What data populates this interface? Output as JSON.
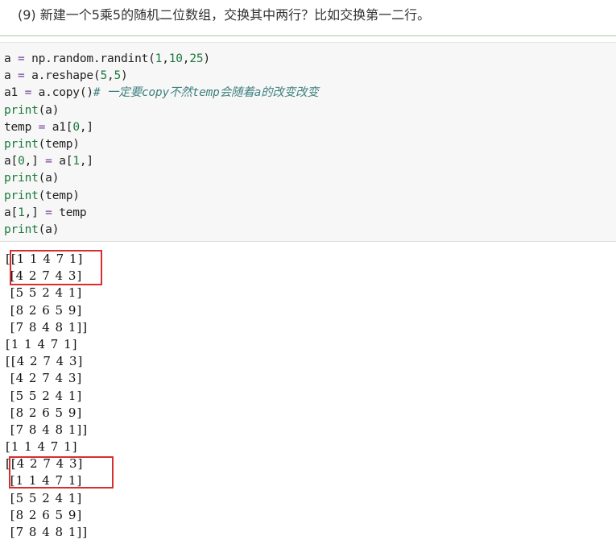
{
  "heading": {
    "text": "(9) 新建一个5乘5的随机二位数组，交换其中两行？比如交换第一二行。"
  },
  "code": {
    "lines": [
      [
        {
          "t": "a",
          "c": "var"
        },
        {
          "t": " = ",
          "c": "op"
        },
        {
          "t": "np.random.randint(",
          "c": "var"
        },
        {
          "t": "1",
          "c": "num"
        },
        {
          "t": ",",
          "c": "var"
        },
        {
          "t": "10",
          "c": "num"
        },
        {
          "t": ",",
          "c": "var"
        },
        {
          "t": "25",
          "c": "num"
        },
        {
          "t": ")",
          "c": "var"
        }
      ],
      [
        {
          "t": "a",
          "c": "var"
        },
        {
          "t": " = ",
          "c": "op"
        },
        {
          "t": "a.reshape(",
          "c": "var"
        },
        {
          "t": "5",
          "c": "num"
        },
        {
          "t": ",",
          "c": "var"
        },
        {
          "t": "5",
          "c": "num"
        },
        {
          "t": ")",
          "c": "var"
        }
      ],
      [
        {
          "t": "a1",
          "c": "var"
        },
        {
          "t": " = ",
          "c": "op"
        },
        {
          "t": "a.copy()",
          "c": "var"
        },
        {
          "t": "# 一定要copy不然temp会随着a的改变改变",
          "c": "comment"
        }
      ],
      [
        {
          "t": "print",
          "c": "fn"
        },
        {
          "t": "(a)",
          "c": "var"
        }
      ],
      [
        {
          "t": "temp",
          "c": "var"
        },
        {
          "t": " = ",
          "c": "op"
        },
        {
          "t": "a1[",
          "c": "var"
        },
        {
          "t": "0",
          "c": "num"
        },
        {
          "t": ",]",
          "c": "var"
        }
      ],
      [
        {
          "t": "print",
          "c": "fn"
        },
        {
          "t": "(temp)",
          "c": "var"
        }
      ],
      [
        {
          "t": "a[",
          "c": "var"
        },
        {
          "t": "0",
          "c": "num"
        },
        {
          "t": ",]",
          "c": "var"
        },
        {
          "t": " = ",
          "c": "op"
        },
        {
          "t": "a[",
          "c": "var"
        },
        {
          "t": "1",
          "c": "num"
        },
        {
          "t": ",]",
          "c": "var"
        }
      ],
      [
        {
          "t": "print",
          "c": "fn"
        },
        {
          "t": "(a)",
          "c": "var"
        }
      ],
      [
        {
          "t": "print",
          "c": "fn"
        },
        {
          "t": "(temp)",
          "c": "var"
        }
      ],
      [
        {
          "t": "a[",
          "c": "var"
        },
        {
          "t": "1",
          "c": "num"
        },
        {
          "t": ",]",
          "c": "var"
        },
        {
          "t": " = ",
          "c": "op"
        },
        {
          "t": "temp",
          "c": "var"
        }
      ],
      [
        {
          "t": "print",
          "c": "fn"
        },
        {
          "t": "(a)",
          "c": "var"
        }
      ]
    ]
  },
  "output": {
    "lines": [
      "[[1 1 4 7 1]",
      " [4 2 7 4 3]",
      " [5 5 2 4 1]",
      " [8 2 6 5 9]",
      " [7 8 4 8 1]]",
      "[1 1 4 7 1]",
      "[[4 2 7 4 3]",
      " [4 2 7 4 3]",
      " [5 5 2 4 1]",
      " [8 2 6 5 9]",
      " [7 8 4 8 1]]",
      "[1 1 4 7 1]",
      "[[4 2 7 4 3]",
      " [1 1 4 7 1]",
      " [5 5 2 4 1]",
      " [8 2 6 5 9]",
      " [7 8 4 8 1]]"
    ]
  },
  "colors": {
    "highlight_box": "#d62f2f",
    "heading_rule": "#9fd09f",
    "code_background": "#f7f7f7"
  }
}
